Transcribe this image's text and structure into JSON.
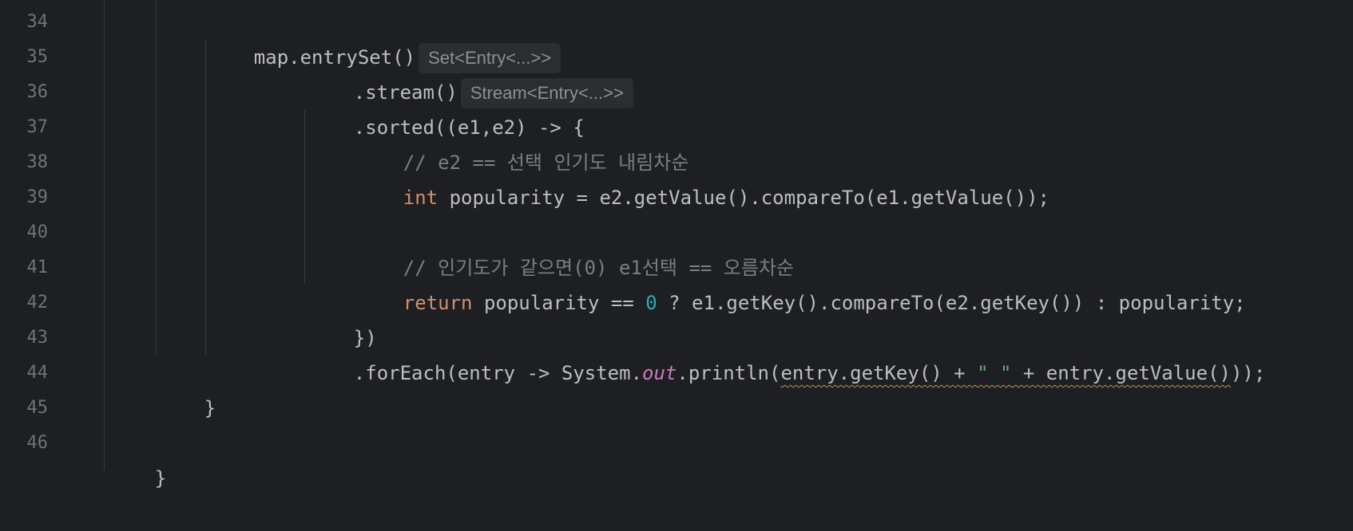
{
  "line_numbers": [
    "34",
    "35",
    "36",
    "37",
    "38",
    "39",
    "40",
    "41",
    "42",
    "43",
    "44",
    "45",
    "46"
  ],
  "code": {
    "l34": {
      "a": "map.entrySet()",
      "hint": "Set<Entry<...>>"
    },
    "l35": {
      "a": ".stream()",
      "hint": "Stream<Entry<...>>"
    },
    "l36": {
      "a": ".sorted((e1,e2) -> {"
    },
    "l37": {
      "comment": "// e2 == 선택 인기도 내림차순"
    },
    "l38": {
      "kw": "int",
      "rest": " popularity = e2.getValue().compareTo(e1.getValue());"
    },
    "l40": {
      "comment": "// 인기도가 같으면(0) e1선택 == 오름차순"
    },
    "l41": {
      "kw": "return",
      "a": " popularity == ",
      "num": "0",
      "b": " ? e1.getKey().compareTo(e2.getKey()) : popularity;"
    },
    "l42": {
      "a": "})"
    },
    "l43": {
      "a": ".forEach(entry -> System.",
      "static": "out",
      "b": ".println(",
      "w1": "entry.getKey() + ",
      "str": "\" \"",
      "w2": " + entry.getValue()",
      "c": "));"
    },
    "l44": {
      "a": "}"
    },
    "l46": {
      "a": "}"
    }
  },
  "colors": {
    "background": "#1e1f22",
    "keyword": "#cf8e6d",
    "number": "#2aacb8",
    "string": "#6aab73",
    "comment": "#7a7e85",
    "static_field": "#c77dbb",
    "warning_underline": "#b29b43"
  }
}
